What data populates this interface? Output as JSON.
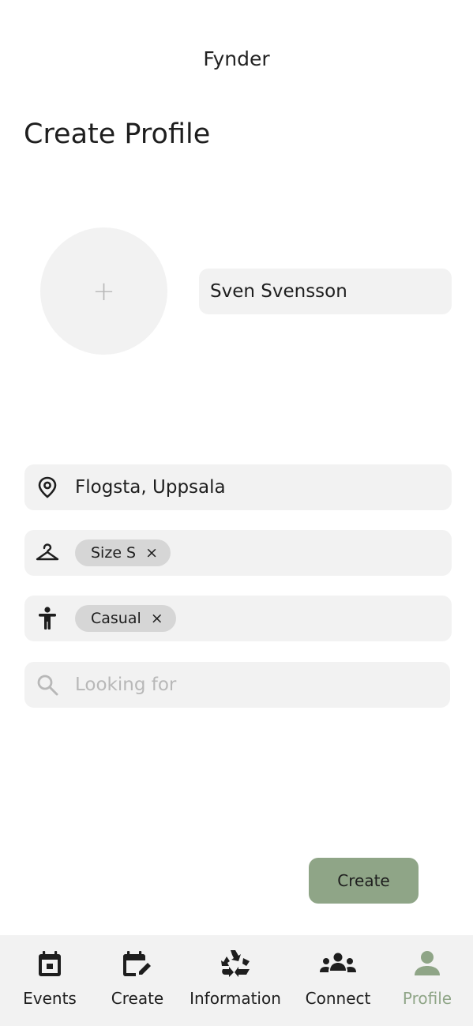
{
  "app": {
    "title": "Fynder"
  },
  "page": {
    "title": "Create Profile"
  },
  "avatar": {
    "add_symbol": "+"
  },
  "form": {
    "name": {
      "value": "Sven Svensson"
    },
    "location": {
      "value": "Flogsta, Uppsala",
      "icon": "location-pin-icon"
    },
    "size": {
      "icon": "hanger-icon",
      "chips": [
        {
          "label": "Size S",
          "remove": "×"
        }
      ]
    },
    "style": {
      "icon": "person-icon",
      "chips": [
        {
          "label": "Casual",
          "remove": "×"
        }
      ]
    },
    "looking_for": {
      "placeholder": "Looking for",
      "icon": "search-icon"
    }
  },
  "actions": {
    "create_label": "Create"
  },
  "bottom_nav": {
    "items": [
      {
        "label": "Events",
        "icon": "calendar-icon",
        "active": false
      },
      {
        "label": "Create",
        "icon": "calendar-edit-icon",
        "active": false
      },
      {
        "label": "Information",
        "icon": "recycle-icon",
        "active": false
      },
      {
        "label": "Connect",
        "icon": "group-icon",
        "active": false
      },
      {
        "label": "Profile",
        "icon": "person-icon",
        "active": true
      }
    ]
  },
  "colors": {
    "accent": "#8fa587",
    "field_background": "#f2f2f2",
    "chip_background": "#d6d6d6",
    "nav_background": "#f2f2f2",
    "placeholder": "#b8b8b8"
  }
}
